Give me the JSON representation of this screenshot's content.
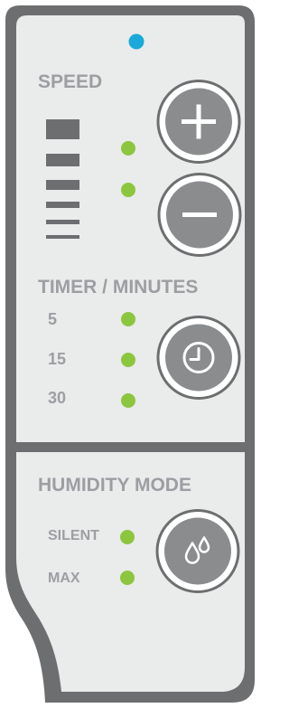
{
  "speed": {
    "title": "SPEED",
    "plus_icon": "plus-icon",
    "minus_icon": "minus-icon"
  },
  "timer": {
    "title": "TIMER / MINUTES",
    "options": [
      "5",
      "15",
      "30"
    ],
    "icon": "clock-icon"
  },
  "humidity": {
    "title": "HUMIDITY MODE",
    "options": [
      "SILENT",
      "MAX"
    ],
    "icon": "water-drops-icon"
  },
  "colors": {
    "panel_bg": "#eaebeb",
    "panel_border": "#6d6e70",
    "text": "#9c9fa2",
    "indicator_green": "#8cc63f",
    "power_indicator_blue": "#1aa9d9",
    "button_fill": "#8a8c8e"
  }
}
